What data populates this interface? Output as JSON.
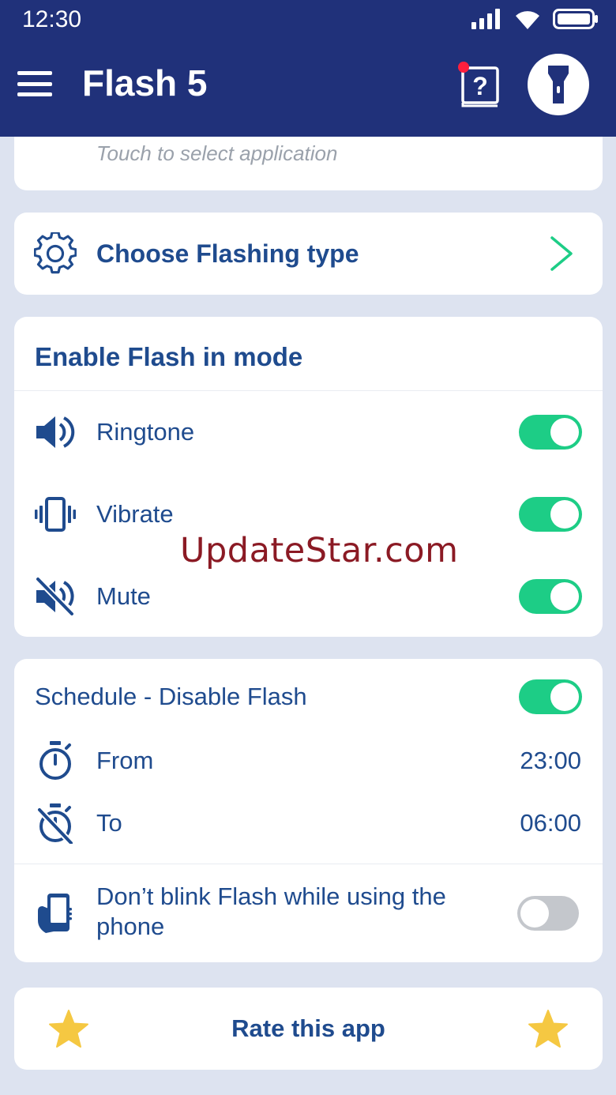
{
  "status_bar": {
    "time": "12:30"
  },
  "app_bar": {
    "title": "Flash 5",
    "help_label": "?"
  },
  "top_card": {
    "hint": "Touch to select application"
  },
  "flashing_type": {
    "label": "Choose Flashing type"
  },
  "enable_modes": {
    "title": "Enable Flash in mode",
    "items": [
      {
        "label": "Ringtone",
        "enabled": true
      },
      {
        "label": "Vibrate",
        "enabled": true
      },
      {
        "label": "Mute",
        "enabled": true
      }
    ]
  },
  "schedule": {
    "title": "Schedule - Disable Flash",
    "enabled": true,
    "from_label": "From",
    "from_value": "23:00",
    "to_label": "To",
    "to_value": "06:00",
    "dont_blink_label_line1": "Don’t blink Flash while using the",
    "dont_blink_label_line2": "phone",
    "dont_blink_enabled": false
  },
  "rate": {
    "label": "Rate this app"
  },
  "watermark": "UpdateStar.com",
  "colors": {
    "app_bar": "#20317a",
    "accent_text": "#1f4b8e",
    "toggle_on": "#1dcd86",
    "toggle_off": "#c4c7cc",
    "chevron": "#1dcd86",
    "star": "#f5c842",
    "background": "#dde3f0"
  },
  "icons": [
    "menu-icon",
    "help-book-icon",
    "flashlight-icon",
    "gear-icon",
    "chevron-right-icon",
    "speaker-icon",
    "vibrate-icon",
    "mute-icon",
    "stopwatch-icon",
    "timer-off-icon",
    "hand-phone-icon",
    "star-icon"
  ]
}
